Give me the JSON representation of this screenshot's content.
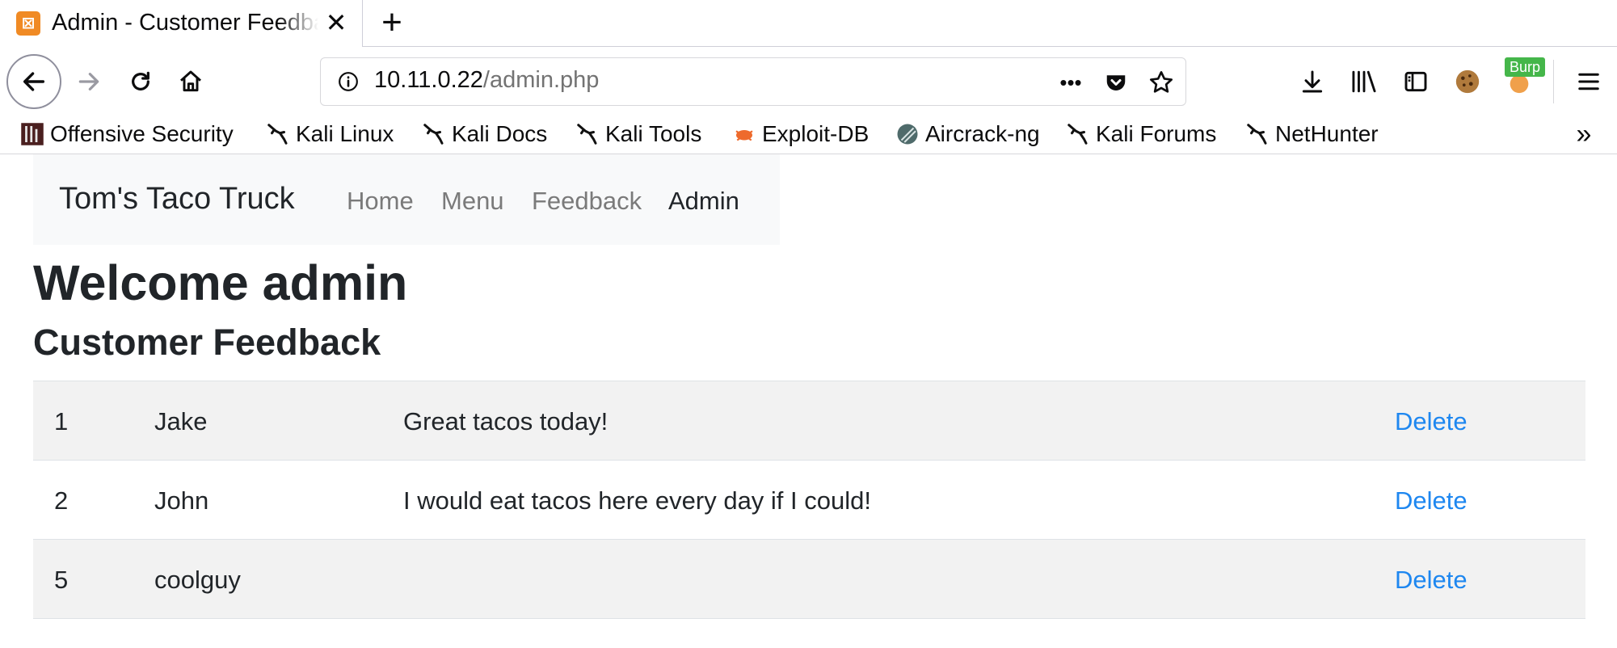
{
  "browser": {
    "tab_title": "Admin - Customer Feedback",
    "tab_close_glyph": "✕",
    "new_tab_glyph": "+",
    "url_host": "10.11.0.22",
    "url_path": "/admin.php",
    "more_glyph": "•••",
    "burp_badge": "Burp",
    "menu_glyph": "☰",
    "overflow_glyph": "»",
    "icons": {
      "back": "back-arrow-icon",
      "forward": "forward-arrow-icon",
      "reload": "reload-icon",
      "home": "home-icon",
      "info": "info-icon",
      "pocket": "pocket-icon",
      "bookmark_star": "star-icon",
      "download": "download-icon",
      "library": "library-icon",
      "sidebar": "sidebar-icon",
      "cookie": "cookie-icon",
      "burp": "burp-icon",
      "menu": "hamburger-menu-icon"
    }
  },
  "bookmarks": [
    {
      "label": "Offensive Security",
      "icon": "offsec-icon"
    },
    {
      "label": "Kali Linux",
      "icon": "kali-dragon-icon"
    },
    {
      "label": "Kali Docs",
      "icon": "kali-dragon-icon"
    },
    {
      "label": "Kali Tools",
      "icon": "kali-dragon-icon"
    },
    {
      "label": "Exploit-DB",
      "icon": "exploitdb-bug-icon"
    },
    {
      "label": "Aircrack-ng",
      "icon": "aircrack-icon"
    },
    {
      "label": "Kali Forums",
      "icon": "kali-dragon-icon"
    },
    {
      "label": "NetHunter",
      "icon": "kali-dragon-icon"
    }
  ],
  "site": {
    "brand": "Tom's Taco Truck",
    "nav": [
      {
        "label": "Home",
        "active": false
      },
      {
        "label": "Menu",
        "active": false
      },
      {
        "label": "Feedback",
        "active": false
      },
      {
        "label": "Admin",
        "active": true
      }
    ],
    "welcome": "Welcome admin",
    "section_title": "Customer Feedback",
    "feedback": [
      {
        "id": "1",
        "name": "Jake",
        "message": "Great tacos today!",
        "action": "Delete"
      },
      {
        "id": "2",
        "name": "John",
        "message": "I would eat tacos here every day if I could!",
        "action": "Delete"
      },
      {
        "id": "5",
        "name": "coolguy",
        "message": "",
        "action": "Delete"
      }
    ]
  },
  "colors": {
    "link": "#1e87f0",
    "navbar_bg": "#f8f9fa",
    "stripe_bg": "#f2f2f2",
    "favicon": "#f08a24",
    "burp_badge": "#45b64a"
  }
}
